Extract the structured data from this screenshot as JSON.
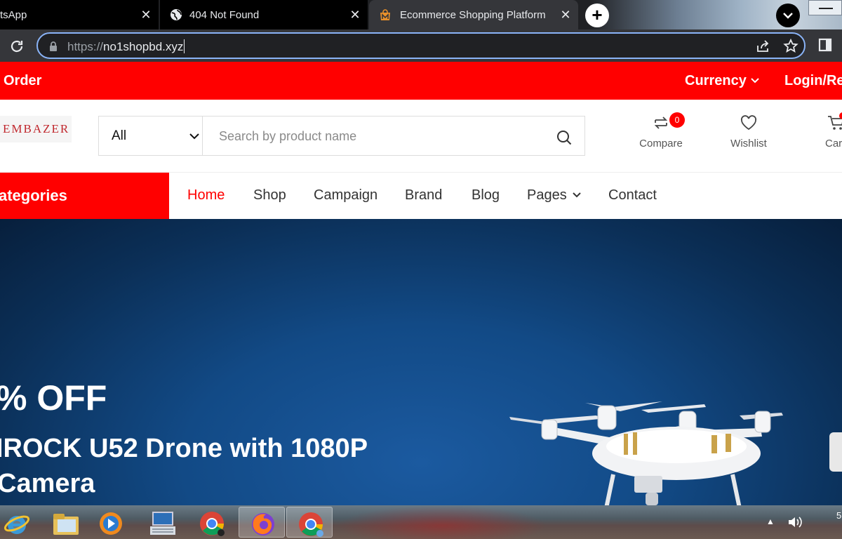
{
  "browser": {
    "tabs": [
      {
        "title": "tsApp",
        "close": "✕"
      },
      {
        "title": "404 Not Found",
        "close": "✕"
      },
      {
        "title": "Ecommerce Shopping Platform",
        "close": "✕"
      }
    ],
    "new_tab": "+",
    "url_scheme": "https://",
    "url_host": "no1shopbd.xyz"
  },
  "topbar": {
    "order": "Order",
    "currency": "Currency",
    "login": "Login/Reg"
  },
  "header": {
    "logo": "EMBAZER",
    "category_value": "All",
    "search_placeholder": "Search by product name",
    "compare_label": "Compare",
    "compare_count": "0",
    "wishlist_label": "Wishlist",
    "cart_label": "Car"
  },
  "nav": {
    "categories": "ategories",
    "items": [
      {
        "label": "Home"
      },
      {
        "label": "Shop"
      },
      {
        "label": "Campaign"
      },
      {
        "label": "Brand"
      },
      {
        "label": "Blog"
      },
      {
        "label": "Pages"
      },
      {
        "label": "Contact"
      }
    ]
  },
  "hero": {
    "discount": "% OFF",
    "product_line1": "IROCK U52 Drone with 1080P",
    "product_line2": "Camera"
  },
  "taskbar": {
    "clock": "5"
  },
  "colors": {
    "accent": "#ff0000",
    "hero_blue": "#124a86",
    "chrome_dark": "#202124"
  }
}
